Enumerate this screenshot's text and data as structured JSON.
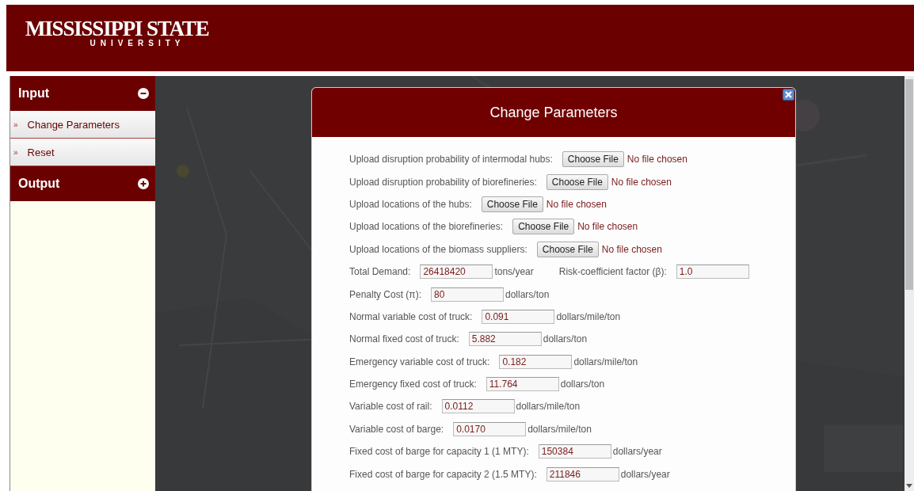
{
  "header": {
    "logo_main": "MISSISSIPPI STATE",
    "logo_sub": "UNIVERSITY"
  },
  "sidebar": {
    "sections": [
      {
        "title": "Input",
        "expanded": true,
        "items": [
          {
            "marker": "»",
            "label": "Change Parameters"
          },
          {
            "marker": "»",
            "label": "Reset"
          }
        ]
      },
      {
        "title": "Output",
        "expanded": false
      }
    ]
  },
  "dialog": {
    "title": "Change Parameters",
    "rows": [
      {
        "items": [
          {
            "kind": "label",
            "text": "Upload disruption probability of intermodal hubs:"
          },
          {
            "kind": "file",
            "button": "Choose File",
            "status": "No file chosen"
          }
        ]
      },
      {
        "items": [
          {
            "kind": "label",
            "text": "Upload disruption probability of biorefineries:"
          },
          {
            "kind": "file",
            "button": "Choose File",
            "status": "No file chosen"
          }
        ]
      },
      {
        "items": [
          {
            "kind": "label",
            "text": "Upload locations of the hubs:"
          },
          {
            "kind": "file",
            "button": "Choose File",
            "status": "No file chosen"
          }
        ]
      },
      {
        "items": [
          {
            "kind": "label",
            "text": "Upload locations of the biorefineries:"
          },
          {
            "kind": "file",
            "button": "Choose File",
            "status": "No file chosen"
          }
        ]
      },
      {
        "items": [
          {
            "kind": "label",
            "text": "Upload locations of the biomass suppliers:"
          },
          {
            "kind": "file",
            "button": "Choose File",
            "status": "No file chosen"
          }
        ]
      },
      {
        "items": [
          {
            "kind": "label",
            "text": "Total Demand:"
          },
          {
            "kind": "input",
            "value": "26418420"
          },
          {
            "kind": "unit",
            "text": "tons/year"
          },
          {
            "kind": "label",
            "text": "Risk-coefficient factor (β):"
          },
          {
            "kind": "input",
            "value": "1.0"
          }
        ]
      },
      {
        "items": [
          {
            "kind": "label",
            "text": "Penalty Cost (π):"
          },
          {
            "kind": "input",
            "value": "80"
          },
          {
            "kind": "unit",
            "text": "dollars/ton"
          }
        ]
      },
      {
        "items": [
          {
            "kind": "label",
            "text": "Normal variable cost of truck:"
          },
          {
            "kind": "input",
            "value": "0.091"
          },
          {
            "kind": "unit",
            "text": "dollars/mile/ton"
          }
        ]
      },
      {
        "items": [
          {
            "kind": "label",
            "text": "Normal fixed cost of truck:"
          },
          {
            "kind": "input",
            "value": "5.882"
          },
          {
            "kind": "unit",
            "text": "dollars/ton"
          }
        ]
      },
      {
        "items": [
          {
            "kind": "label",
            "text": "Emergency variable cost of truck:"
          },
          {
            "kind": "input",
            "value": "0.182"
          },
          {
            "kind": "unit",
            "text": "dollars/mile/ton"
          }
        ]
      },
      {
        "items": [
          {
            "kind": "label",
            "text": "Emergency fixed cost of truck:"
          },
          {
            "kind": "input",
            "value": "11.764"
          },
          {
            "kind": "unit",
            "text": "dollars/ton"
          }
        ]
      },
      {
        "items": [
          {
            "kind": "label",
            "text": "Variable cost of rail:"
          },
          {
            "kind": "input",
            "value": "0.0112"
          },
          {
            "kind": "unit",
            "text": "dollars/mile/ton"
          }
        ]
      },
      {
        "items": [
          {
            "kind": "label",
            "text": "Variable cost of barge:"
          },
          {
            "kind": "input",
            "value": "0.0170"
          },
          {
            "kind": "unit",
            "text": "dollars/mile/ton"
          }
        ]
      },
      {
        "items": [
          {
            "kind": "label",
            "text": "Fixed cost of barge for capacity 1 (1 MTY):"
          },
          {
            "kind": "input",
            "value": "150384"
          },
          {
            "kind": "unit",
            "text": "dollars/year"
          }
        ]
      },
      {
        "items": [
          {
            "kind": "label",
            "text": "Fixed cost of barge for capacity 2 (1.5 MTY):"
          },
          {
            "kind": "input",
            "value": "211846"
          },
          {
            "kind": "unit",
            "text": "dollars/year"
          }
        ]
      }
    ]
  }
}
